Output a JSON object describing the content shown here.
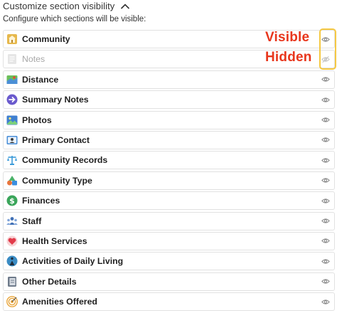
{
  "header": {
    "title": "Customize section visibility",
    "toggle_icon": "chevron-up-icon"
  },
  "subtitle": "Configure which sections will be visible:",
  "annotations": {
    "visible": "Visible",
    "hidden": "Hidden",
    "color": "#e8361c",
    "highlight_color": "#f5c842"
  },
  "sections": [
    {
      "label": "Community",
      "icon": "community-building-icon",
      "visible": true
    },
    {
      "label": "Notes",
      "icon": "notes-icon",
      "visible": false
    },
    {
      "label": "Distance",
      "icon": "map-icon",
      "visible": true
    },
    {
      "label": "Summary Notes",
      "icon": "summary-arrow-icon",
      "visible": true
    },
    {
      "label": "Photos",
      "icon": "photos-icon",
      "visible": true
    },
    {
      "label": "Primary Contact",
      "icon": "contact-card-icon",
      "visible": true
    },
    {
      "label": "Community Records",
      "icon": "scales-icon",
      "visible": true
    },
    {
      "label": "Community Type",
      "icon": "shapes-icon",
      "visible": true
    },
    {
      "label": "Finances",
      "icon": "dollar-icon",
      "visible": true
    },
    {
      "label": "Staff",
      "icon": "staff-people-icon",
      "visible": true
    },
    {
      "label": "Health Services",
      "icon": "heart-health-icon",
      "visible": true
    },
    {
      "label": "Activities of Daily Living",
      "icon": "person-activity-icon",
      "visible": true
    },
    {
      "label": "Other Details",
      "icon": "notebook-icon",
      "visible": true
    },
    {
      "label": "Amenities Offered",
      "icon": "target-icon",
      "visible": true
    }
  ]
}
